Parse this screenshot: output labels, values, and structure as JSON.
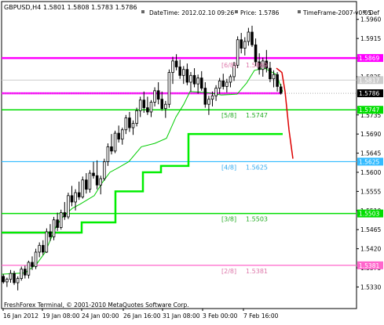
{
  "window": {
    "symbol_label": "GBPUSD,H4",
    "ohlc_label": "1.5801 1.5808 1.5783 1.5786"
  },
  "info_line": {
    "datetime_label": "DateTime: 2012.02.10 09:26",
    "price_label": "Price: 1.5786",
    "timeframe_label": "TimeFrame-2007-v0.05",
    "def_label": "Def"
  },
  "footer": {
    "copyright": "FreshForex Terminal, © 2001-2010 MetaQuotes Software Corp."
  },
  "colors": {
    "background": "#ffffff",
    "candle": "#000000",
    "magenta_level": "#ff00ff",
    "pink_level": "#ff66cc",
    "green_level": "#00dd00",
    "cyan_level": "#33bbff",
    "trail_line": "#00cc00",
    "stair_line": "#00ee00",
    "projection": "#dd0000",
    "bid_line": "#aaaaaa",
    "level_label_pink": "#dd77aa",
    "level_label_green": "#22aa22",
    "level_label_cyan": "#33aaee"
  },
  "chart_data": {
    "type": "candlestick",
    "ylim": [
      1.5305,
      1.5965
    ],
    "y_ticks": [
      "1.5960",
      "1.5915",
      "1.5869",
      "1.5825",
      "1.5786",
      "1.5735",
      "1.5690",
      "1.5645",
      "1.5600",
      "1.5555",
      "1.5510",
      "1.5465",
      "1.5420",
      "1.5375",
      "1.5330"
    ],
    "x_ticks": [
      "16 Jan 2012",
      "19 Jan 08:00",
      "24 Jan 00:00",
      "26 Jan 16:00",
      "31 Jan 08:00",
      "3 Feb 00:00",
      "7 Feb 16:00"
    ],
    "current_price": "1.5786",
    "bid_line_value": 1.5786,
    "levels": [
      {
        "id": "8_8",
        "fraction": "",
        "value": 1.5869,
        "price_label": "1.5869",
        "color": "magenta",
        "x_start": 0,
        "line_label": ""
      },
      {
        "id": "7_8",
        "fraction": "",
        "value": 1.5817,
        "price_label": "1.5817",
        "color": "gray",
        "x_start": 0,
        "line_label": ""
      },
      {
        "id": "6_8",
        "fraction": "[6/8]",
        "value": 1.5869,
        "price_label": "",
        "color": "magenta",
        "x_start": 0,
        "line_label": "1.5869"
      },
      {
        "id": "5_8",
        "fraction": "[5/8]",
        "value": 1.5747,
        "price_label": "1.5747",
        "color": "green",
        "x_start": 0,
        "line_label": "1.5747"
      },
      {
        "id": "4_8",
        "fraction": "[4/8]",
        "value": 1.5625,
        "price_label": "1.5625",
        "color": "cyan",
        "x_start": 0,
        "line_label": "1.5625"
      },
      {
        "id": "3_8",
        "fraction": "[3/8]",
        "value": 1.5503,
        "price_label": "1.5503",
        "color": "green",
        "x_start": 0,
        "line_label": "1.5503"
      },
      {
        "id": "2_8",
        "fraction": "[2/8]",
        "value": 1.5381,
        "price_label": "1.5381",
        "color": "pink",
        "x_start": 0,
        "line_label": "1.5381"
      }
    ],
    "magenta_level_upper": 1.5869,
    "magenta_level_lower": 1.5786,
    "magenta_short_lower": 1.5458,
    "magenta_short_start": 1.5395,
    "stair_line": [
      [
        0,
        1.5458
      ],
      [
        102,
        1.5458
      ],
      [
        102,
        1.5482
      ],
      [
        145,
        1.5482
      ],
      [
        145,
        1.5555
      ],
      [
        180,
        1.5555
      ],
      [
        180,
        1.56
      ],
      [
        203,
        1.56
      ],
      [
        203,
        1.5615
      ],
      [
        238,
        1.5615
      ],
      [
        238,
        1.569
      ],
      [
        358,
        1.569
      ]
    ],
    "trail_line": [
      [
        0,
        1.536
      ],
      [
        30,
        1.5363
      ],
      [
        45,
        1.5385
      ],
      [
        55,
        1.541
      ],
      [
        62,
        1.544
      ],
      [
        70,
        1.5475
      ],
      [
        78,
        1.5495
      ],
      [
        90,
        1.5515
      ],
      [
        100,
        1.5525
      ],
      [
        118,
        1.5545
      ],
      [
        128,
        1.5575
      ],
      [
        138,
        1.56
      ],
      [
        148,
        1.561
      ],
      [
        162,
        1.5625
      ],
      [
        178,
        1.566
      ],
      [
        195,
        1.5668
      ],
      [
        210,
        1.568
      ],
      [
        222,
        1.573
      ],
      [
        232,
        1.576
      ],
      [
        240,
        1.579
      ],
      [
        260,
        1.5788
      ],
      [
        280,
        1.5782
      ],
      [
        300,
        1.5784
      ],
      [
        312,
        1.581
      ],
      [
        322,
        1.584
      ],
      [
        335,
        1.5845
      ],
      [
        350,
        1.583
      ],
      [
        358,
        1.579
      ]
    ],
    "projection": [
      [
        350,
        1.5845
      ],
      [
        357,
        1.5835
      ],
      [
        361,
        1.579
      ],
      [
        366,
        1.57
      ],
      [
        371,
        1.5632
      ]
    ],
    "candles": [
      [
        1.5355,
        1.536,
        1.5338,
        1.5342
      ],
      [
        1.5342,
        1.5352,
        1.533,
        1.5348
      ],
      [
        1.5348,
        1.537,
        1.534,
        1.5362
      ],
      [
        1.5362,
        1.5368,
        1.5335,
        1.534
      ],
      [
        1.534,
        1.5355,
        1.5322,
        1.535
      ],
      [
        1.535,
        1.5378,
        1.5345,
        1.5372
      ],
      [
        1.5372,
        1.538,
        1.535,
        1.5358
      ],
      [
        1.5358,
        1.5392,
        1.535,
        1.5388
      ],
      [
        1.5388,
        1.5402,
        1.537,
        1.5378
      ],
      [
        1.5378,
        1.542,
        1.5372,
        1.5412
      ],
      [
        1.5412,
        1.5435,
        1.54,
        1.5428
      ],
      [
        1.5428,
        1.544,
        1.5405,
        1.5412
      ],
      [
        1.5412,
        1.5468,
        1.541,
        1.546
      ],
      [
        1.546,
        1.5478,
        1.5438,
        1.5448
      ],
      [
        1.5448,
        1.5495,
        1.544,
        1.5488
      ],
      [
        1.5488,
        1.5505,
        1.5462,
        1.547
      ],
      [
        1.547,
        1.5512,
        1.5465,
        1.5505
      ],
      [
        1.5505,
        1.553,
        1.5488,
        1.5495
      ],
      [
        1.5495,
        1.5552,
        1.549,
        1.5545
      ],
      [
        1.5545,
        1.5568,
        1.552,
        1.553
      ],
      [
        1.553,
        1.556,
        1.551,
        1.5552
      ],
      [
        1.5552,
        1.5578,
        1.5535,
        1.5542
      ],
      [
        1.5542,
        1.559,
        1.5538,
        1.5582
      ],
      [
        1.5582,
        1.5598,
        1.555,
        1.556
      ],
      [
        1.556,
        1.5605,
        1.5552,
        1.5598
      ],
      [
        1.5598,
        1.5625,
        1.5585,
        1.5592
      ],
      [
        1.5592,
        1.5628,
        1.556,
        1.557
      ],
      [
        1.557,
        1.5592,
        1.5548,
        1.5585
      ],
      [
        1.5585,
        1.5632,
        1.558,
        1.5625
      ],
      [
        1.5625,
        1.5668,
        1.5615,
        1.566
      ],
      [
        1.566,
        1.569,
        1.5642,
        1.565
      ],
      [
        1.565,
        1.5698,
        1.5645,
        1.5692
      ],
      [
        1.5692,
        1.571,
        1.567,
        1.5678
      ],
      [
        1.5678,
        1.5705,
        1.5665,
        1.57
      ],
      [
        1.57,
        1.5735,
        1.569,
        1.5728
      ],
      [
        1.5728,
        1.5742,
        1.5695,
        1.5705
      ],
      [
        1.5705,
        1.5722,
        1.5688,
        1.5715
      ],
      [
        1.5715,
        1.5752,
        1.5708,
        1.5745
      ],
      [
        1.5745,
        1.5778,
        1.573,
        1.577
      ],
      [
        1.577,
        1.579,
        1.574,
        1.5752
      ],
      [
        1.5752,
        1.5778,
        1.5735,
        1.5742
      ],
      [
        1.5742,
        1.577,
        1.573,
        1.5765
      ],
      [
        1.5765,
        1.58,
        1.5755,
        1.5792
      ],
      [
        1.5792,
        1.5812,
        1.576,
        1.5772
      ],
      [
        1.5772,
        1.579,
        1.5745,
        1.575
      ],
      [
        1.575,
        1.5768,
        1.5728,
        1.576
      ],
      [
        1.576,
        1.5842,
        1.5752,
        1.5835
      ],
      [
        1.5835,
        1.5872,
        1.5808,
        1.5862
      ],
      [
        1.5862,
        1.5878,
        1.584,
        1.5848
      ],
      [
        1.5848,
        1.5865,
        1.582,
        1.5828
      ],
      [
        1.5828,
        1.585,
        1.5808,
        1.5842
      ],
      [
        1.5842,
        1.5856,
        1.5805,
        1.5812
      ],
      [
        1.5812,
        1.5836,
        1.579,
        1.5828
      ],
      [
        1.5828,
        1.5845,
        1.58,
        1.5808
      ],
      [
        1.5808,
        1.583,
        1.5785,
        1.5822
      ],
      [
        1.5822,
        1.5838,
        1.5792,
        1.5798
      ],
      [
        1.5798,
        1.5812,
        1.5752,
        1.576
      ],
      [
        1.576,
        1.578,
        1.5735,
        1.5772
      ],
      [
        1.5772,
        1.579,
        1.5755,
        1.578
      ],
      [
        1.578,
        1.5805,
        1.5768,
        1.5798
      ],
      [
        1.5798,
        1.5822,
        1.5785,
        1.5815
      ],
      [
        1.5815,
        1.5832,
        1.5795,
        1.5802
      ],
      [
        1.5802,
        1.582,
        1.5788,
        1.5812
      ],
      [
        1.5812,
        1.583,
        1.58,
        1.5825
      ],
      [
        1.5825,
        1.586,
        1.5815,
        1.5852
      ],
      [
        1.5852,
        1.592,
        1.5845,
        1.5912
      ],
      [
        1.5912,
        1.5928,
        1.588,
        1.5892
      ],
      [
        1.5892,
        1.5918,
        1.5875,
        1.5908
      ],
      [
        1.5908,
        1.594,
        1.5898,
        1.593
      ],
      [
        1.593,
        1.5945,
        1.5895,
        1.59
      ],
      [
        1.59,
        1.5915,
        1.585,
        1.586
      ],
      [
        1.586,
        1.588,
        1.583,
        1.5842
      ],
      [
        1.5842,
        1.587,
        1.5825,
        1.5862
      ],
      [
        1.5862,
        1.5888,
        1.5835,
        1.5845
      ],
      [
        1.5845,
        1.586,
        1.5812,
        1.582
      ],
      [
        1.582,
        1.584,
        1.58,
        1.583
      ],
      [
        1.583,
        1.5836,
        1.579,
        1.5802
      ],
      [
        1.5801,
        1.5808,
        1.5783,
        1.5786
      ]
    ]
  }
}
